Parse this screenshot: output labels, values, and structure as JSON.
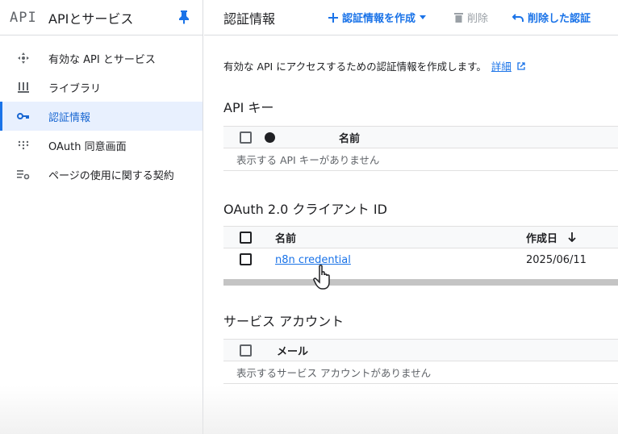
{
  "sidebar": {
    "logo": "API",
    "title": "APIとサービス",
    "items": [
      {
        "label": "有効な API とサービス",
        "icon": "diamond-arrows-icon"
      },
      {
        "label": "ライブラリ",
        "icon": "library-icon"
      },
      {
        "label": "認証情報",
        "icon": "key-icon"
      },
      {
        "label": "OAuth 同意画面",
        "icon": "dots-grid-icon"
      },
      {
        "label": "ページの使用に関する契約",
        "icon": "settings-list-icon"
      }
    ]
  },
  "header": {
    "title": "認証情報",
    "create_label": "認証情報を作成",
    "delete_label": "削除",
    "restore_label": "削除した認証"
  },
  "main": {
    "intro_text": "有効な API にアクセスするための認証情報を作成します。",
    "intro_link": "詳細",
    "api_keys": {
      "title": "API キー",
      "col_name": "名前",
      "empty": "表示する API キーがありません"
    },
    "oauth": {
      "title": "OAuth 2.0 クライアント ID",
      "col_name": "名前",
      "col_created": "作成日",
      "rows": [
        {
          "name": "n8n credential",
          "created": "2025/06/11"
        }
      ]
    },
    "service_accounts": {
      "title": "サービス アカウント",
      "col_email": "メール",
      "empty": "表示するサービス アカウントがありません"
    }
  },
  "colors": {
    "accent": "#1a73e8",
    "active_bg": "#e8f0fe",
    "border": "#dadce0"
  }
}
